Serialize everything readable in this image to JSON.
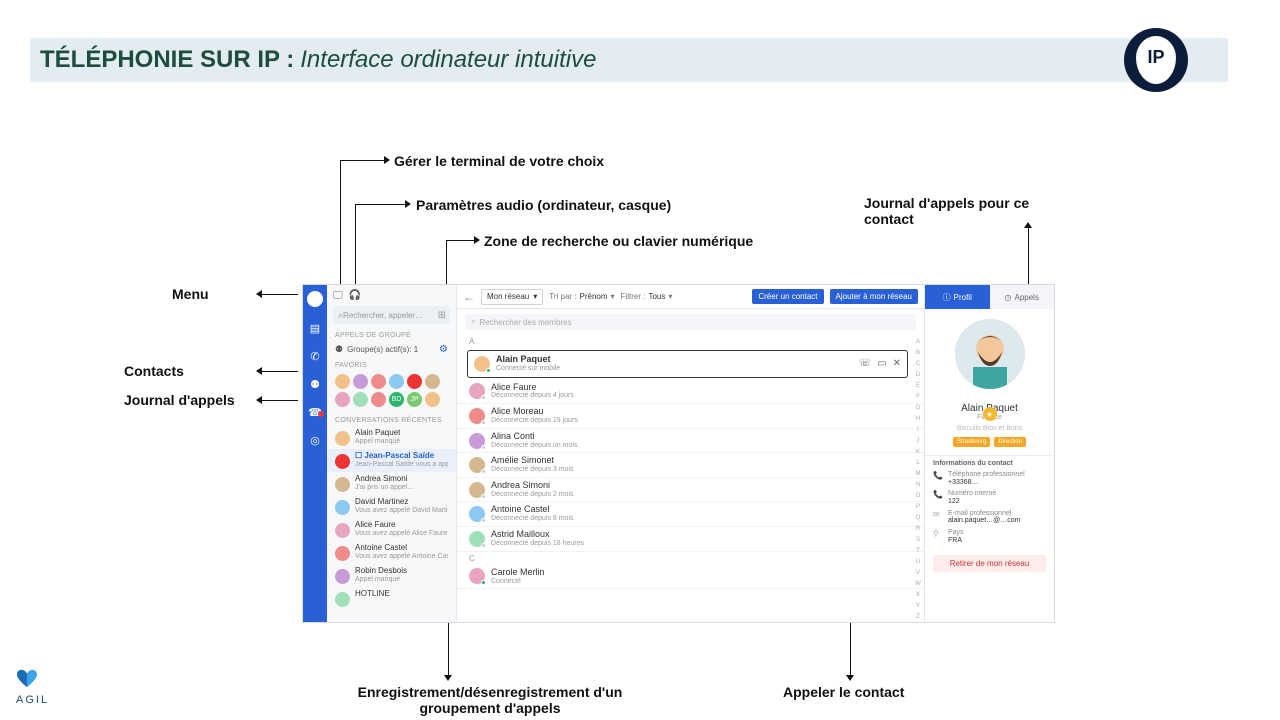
{
  "slide": {
    "title_bold": "TÉLÉPHONIE SUR IP :",
    "title_italic": "Interface ordinateur intuitive",
    "ip_badge": "IP"
  },
  "annotations": {
    "terminal": "Gérer le terminal de votre choix",
    "audio": "Paramètres audio (ordinateur, casque)",
    "search_zone": "Zone de recherche ou clavier numérique",
    "journal_contact": "Journal d'appels pour ce contact",
    "menu": "Menu",
    "contacts": "Contacts",
    "journal": "Journal d'appels",
    "group_reg": "Enregistrement/désenregistrement d'un groupement d'appels",
    "call_contact": "Appeler le contact"
  },
  "left_panel": {
    "search_placeholder": "Rechercher, appeler…",
    "section_groups": "APPELS DE GROUPE",
    "group_row": "Groupe(s) actif(s): 1",
    "section_fav": "FAVORIS",
    "section_recent": "CONVERSATIONS RÉCENTES",
    "conversations": [
      {
        "name": "Alain Paquet",
        "sub": "Appel manqué",
        "avatar": "av-a"
      },
      {
        "name": "☐ Jean-Pascal Saïde",
        "sub": "Jean-Pascal Saïde vous a appelé",
        "avatar": "av-h",
        "active": true
      },
      {
        "name": "Andrea Simoni",
        "sub": "J'ai pris un appel…",
        "avatar": "av-g"
      },
      {
        "name": "David Martinez",
        "sub": "Vous avez appelé David Martinez",
        "avatar": "av-d"
      },
      {
        "name": "Alice Faure",
        "sub": "Vous avez appelé Alice Faure",
        "avatar": "av-f"
      },
      {
        "name": "Antoine Castel",
        "sub": "Vous avez appelé Antoine Castel",
        "avatar": "av-c"
      },
      {
        "name": "Robin Desbois",
        "sub": "Appel manqué",
        "avatar": "av-b"
      },
      {
        "name": "HOTLINE",
        "sub": "",
        "avatar": "av-e"
      }
    ]
  },
  "main_panel": {
    "network_select": "Mon réseau",
    "sort_label": "Tri par :",
    "sort_value": "Prénom",
    "filter_label": "Filtrer :",
    "filter_value": "Tous",
    "btn_create": "Créer un contact",
    "btn_add": "Ajouter à mon réseau",
    "search_placeholder": "Rechercher des membres",
    "letters": [
      "A",
      "B",
      "C",
      "D",
      "E",
      "F",
      "G",
      "H",
      "I",
      "J",
      "K",
      "L",
      "M",
      "N",
      "O",
      "P",
      "Q",
      "R",
      "S",
      "T",
      "U",
      "V",
      "W",
      "X",
      "Y",
      "Z"
    ],
    "section_a": "A",
    "section_c": "C",
    "rows_a": [
      {
        "name": "Alain Paquet",
        "sub": "Connecté sur mobile",
        "avatar": "av-a",
        "presence": "#2ab56a",
        "selected": true
      },
      {
        "name": "Alice Faure",
        "sub": "Déconnecté depuis 4 jours",
        "avatar": "av-f",
        "presence": "#ccc"
      },
      {
        "name": "Alice Moreau",
        "sub": "Déconnecté depuis 19 jours",
        "avatar": "av-c",
        "presence": "#ccc"
      },
      {
        "name": "Alina Conti",
        "sub": "Déconnecté depuis un mois",
        "avatar": "av-b",
        "presence": "#ccc"
      },
      {
        "name": "Amélie Simonet",
        "sub": "Déconnecté depuis 3 mois",
        "avatar": "av-g",
        "presence": "#ccc"
      },
      {
        "name": "Andrea Simoni",
        "sub": "Déconnecté depuis 2 mois",
        "avatar": "av-g",
        "presence": "#ccc"
      },
      {
        "name": "Antoine Castel",
        "sub": "Déconnecté depuis 8 mois",
        "avatar": "av-d",
        "presence": "#ccc"
      },
      {
        "name": "Astrid Mailloux",
        "sub": "Déconnecté depuis 18 heures",
        "avatar": "av-e",
        "presence": "#ccc"
      }
    ],
    "rows_c": [
      {
        "name": "Carole Merlin",
        "sub": "Connecté",
        "avatar": "av-f",
        "presence": "#2ab56a"
      }
    ]
  },
  "right_panel": {
    "tab_profile": "Profil",
    "tab_calls": "Appels",
    "name": "Alain Paquet",
    "dept": "Finance",
    "company": "Biscuits Bios et Bons",
    "tag1": "Strasbourg",
    "tag2": "Direction",
    "info_header": "Informations du contact",
    "info": [
      {
        "icon": "📞",
        "label": "Téléphone professionnel",
        "value": "+33368…"
      },
      {
        "icon": "📞",
        "label": "Numéro interne",
        "value": "122"
      },
      {
        "icon": "✉",
        "label": "E-mail professionnel",
        "value": "alain.paquet…@…com"
      },
      {
        "icon": "⚲",
        "label": "Pays",
        "value": "FRA"
      }
    ],
    "remove": "Retirer de mon réseau"
  },
  "logo": "AGIL"
}
